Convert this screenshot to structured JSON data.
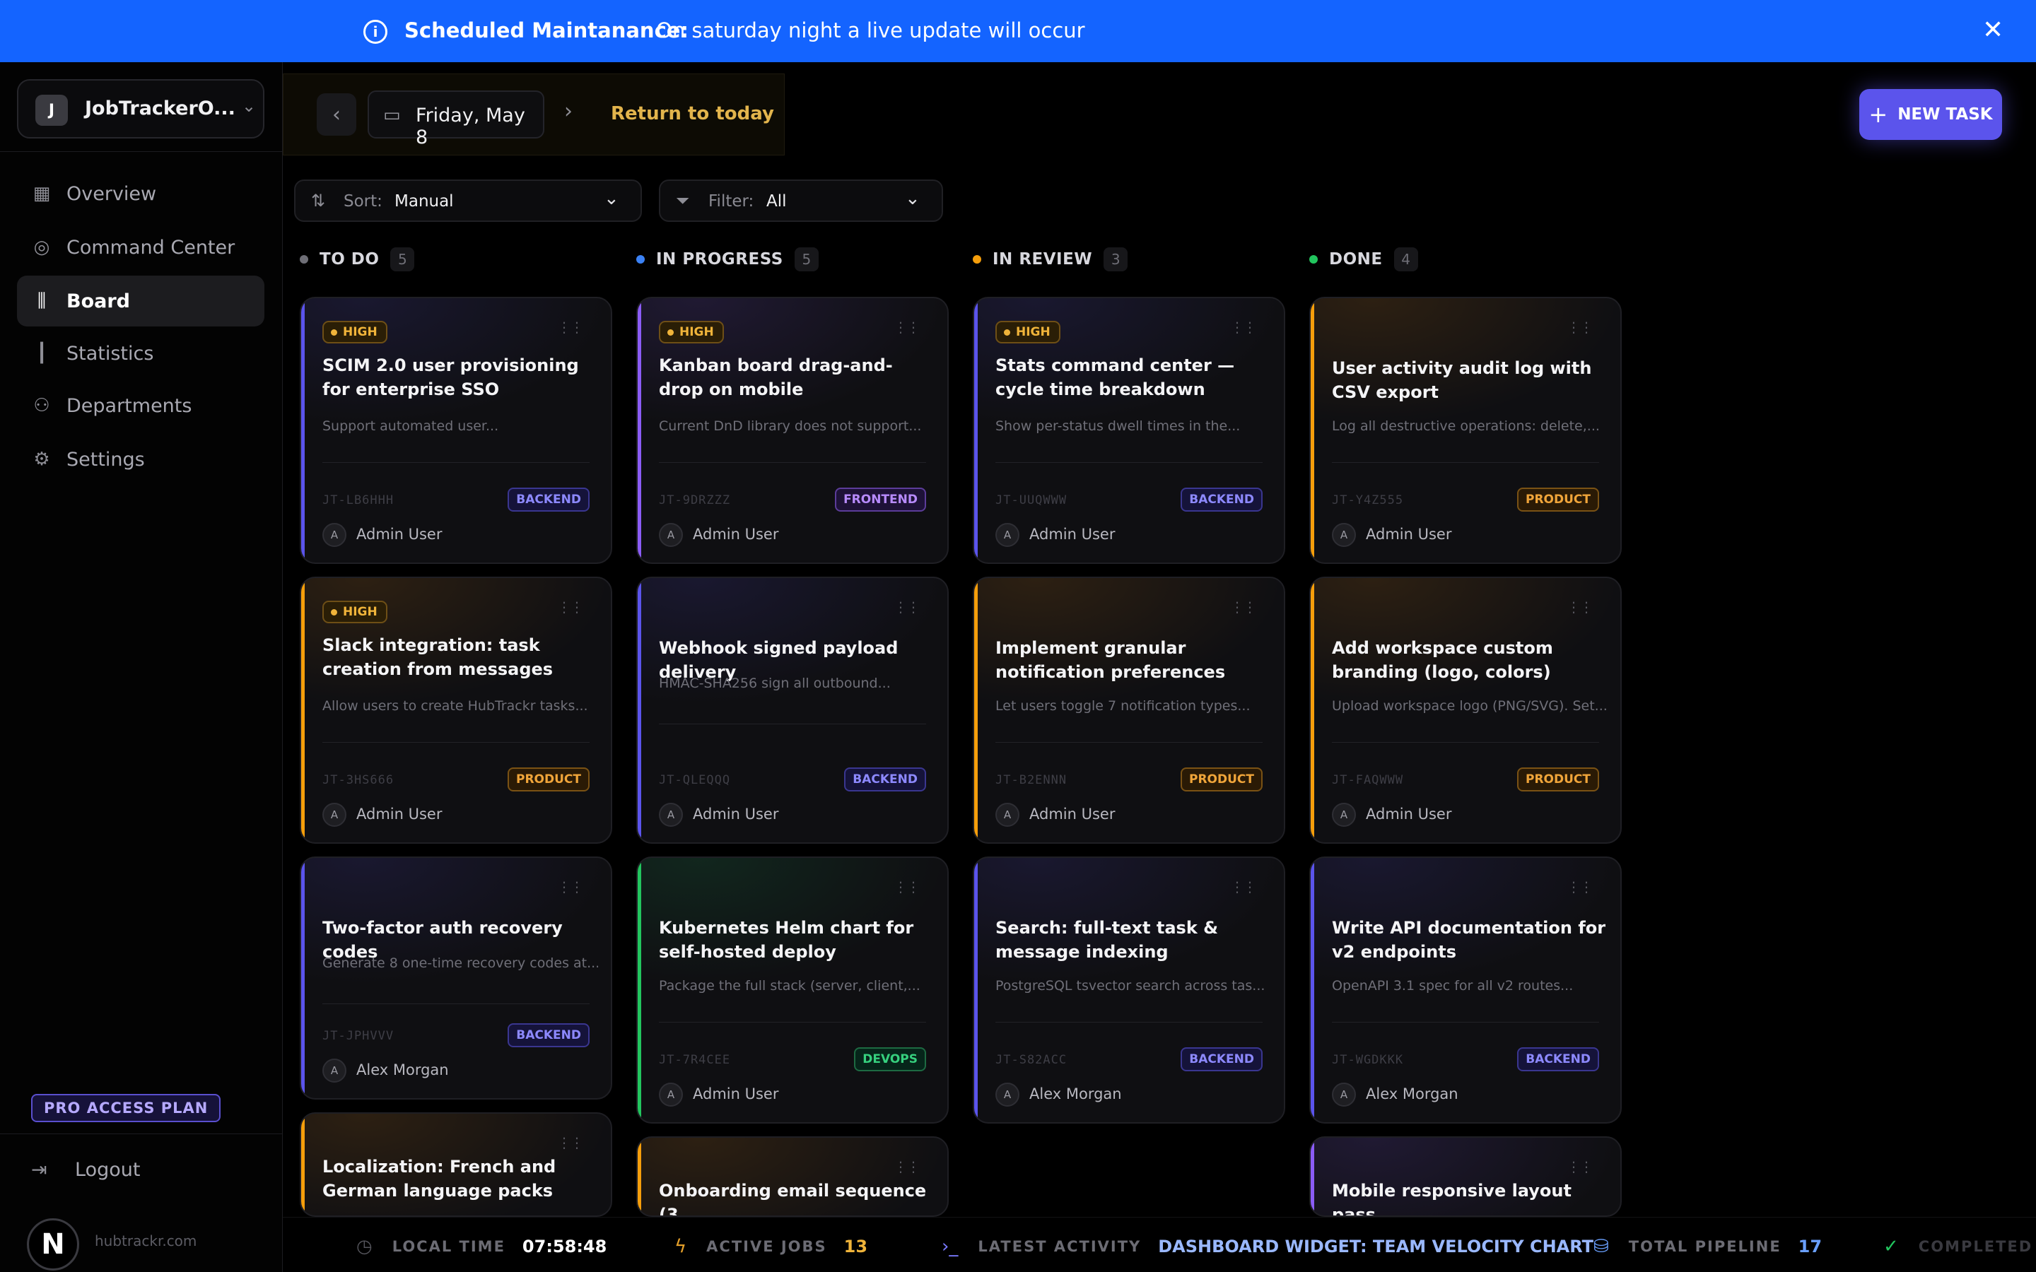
{
  "banner": {
    "title": "Scheduled Maintanance:",
    "text": "On saturday night a live update will occur"
  },
  "sidebar": {
    "workspace_initial": "J",
    "workspace_name": "JobTrackerO...",
    "items": [
      {
        "label": "Overview"
      },
      {
        "label": "Command Center"
      },
      {
        "label": "Board"
      },
      {
        "label": "Statistics"
      },
      {
        "label": "Departments"
      },
      {
        "label": "Settings"
      }
    ],
    "plan": "PRO ACCESS PLAN",
    "logout": "Logout",
    "logo_letter": "N",
    "domain": "hubtrackr.com"
  },
  "toolbar": {
    "date": "Friday, May 8",
    "return_today": "Return to today",
    "new_task": "NEW TASK",
    "sort_label": "Sort:",
    "sort_value": "Manual",
    "filter_label": "Filter:",
    "filter_value": "All"
  },
  "colors": {
    "accent": "#5b54ec",
    "banner": "#1464ff",
    "todo": "#6e6e76",
    "in_progress": "#3b82f6",
    "in_review": "#f59e0b",
    "done": "#22c55e"
  },
  "columns": [
    {
      "title": "TO DO",
      "count": "5",
      "cards": [
        {
          "priority": "HIGH",
          "title": "SCIM 2.0 user provisioning for enterprise SSO",
          "desc": "Support automated user...",
          "id": "JT-LB6HHH",
          "tag": "BACKEND",
          "user_initial": "A",
          "user": "Admin User"
        },
        {
          "priority": "HIGH",
          "title": "Slack integration: task creation from messages",
          "desc": "Allow users to create HubTrackr tasks...",
          "id": "JT-3HS666",
          "tag": "PRODUCT",
          "user_initial": "A",
          "user": "Admin User"
        },
        {
          "title": "Two-factor auth recovery codes",
          "desc": "Generate 8 one-time recovery codes at...",
          "id": "JT-JPHVVV",
          "tag": "BACKEND",
          "user_initial": "A",
          "user": "Alex Morgan"
        },
        {
          "title": "Localization: French and German language packs"
        }
      ]
    },
    {
      "title": "IN PROGRESS",
      "count": "5",
      "cards": [
        {
          "priority": "HIGH",
          "title": "Kanban board drag-and-drop on mobile",
          "desc": "Current DnD library does not support...",
          "id": "JT-9DRZZZ",
          "tag": "FRONTEND",
          "user_initial": "A",
          "user": "Admin User"
        },
        {
          "title": "Webhook signed payload delivery",
          "desc": "HMAC-SHA256 sign all outbound...",
          "id": "JT-QLEQQQ",
          "tag": "BACKEND",
          "user_initial": "A",
          "user": "Admin User"
        },
        {
          "title": "Kubernetes Helm chart for self-hosted deploy",
          "desc": "Package the full stack (server, client,...",
          "id": "JT-7R4CEE",
          "tag": "DEVOPS",
          "user_initial": "A",
          "user": "Admin User"
        },
        {
          "title": "Onboarding email sequence (3"
        }
      ]
    },
    {
      "title": "IN REVIEW",
      "count": "3",
      "cards": [
        {
          "priority": "HIGH",
          "title": "Stats command center — cycle time breakdown",
          "desc": "Show per-status dwell times in the...",
          "id": "JT-UUQWWW",
          "tag": "BACKEND",
          "user_initial": "A",
          "user": "Admin User"
        },
        {
          "title": "Implement granular notification preferences",
          "desc": "Let users toggle 7 notification types...",
          "id": "JT-B2ENNN",
          "tag": "PRODUCT",
          "user_initial": "A",
          "user": "Admin User"
        },
        {
          "title": "Search: full-text task & message indexing",
          "desc": "PostgreSQL tsvector search across tas...",
          "id": "JT-S82ACC",
          "tag": "BACKEND",
          "user_initial": "A",
          "user": "Alex Morgan"
        }
      ]
    },
    {
      "title": "DONE",
      "count": "4",
      "cards": [
        {
          "title": "User activity audit log with CSV export",
          "desc": "Log all destructive operations: delete,...",
          "id": "JT-Y4Z555",
          "tag": "PRODUCT",
          "user_initial": "A",
          "user": "Admin User"
        },
        {
          "title": "Add workspace custom branding (logo, colors)",
          "desc": "Upload workspace logo (PNG/SVG). Set...",
          "id": "JT-FAQWWW",
          "tag": "PRODUCT",
          "user_initial": "A",
          "user": "Admin User"
        },
        {
          "title": "Write API documentation for v2 endpoints",
          "desc": "OpenAPI 3.1 spec for all v2 routes...",
          "id": "JT-WGDKKK",
          "tag": "BACKEND",
          "user_initial": "A",
          "user": "Alex Morgan"
        },
        {
          "title": "Mobile responsive layout pass"
        }
      ]
    }
  ],
  "statusbar": {
    "local_time_label": "LOCAL TIME",
    "local_time": "07:58:48",
    "active_jobs_label": "ACTIVE JOBS",
    "active_jobs": "13",
    "latest_label": "LATEST ACTIVITY",
    "latest": "DASHBOARD WIDGET: TEAM VELOCITY CHART",
    "pipeline_label": "TOTAL PIPELINE",
    "pipeline": "17",
    "completed_label": "COMPLETED"
  }
}
